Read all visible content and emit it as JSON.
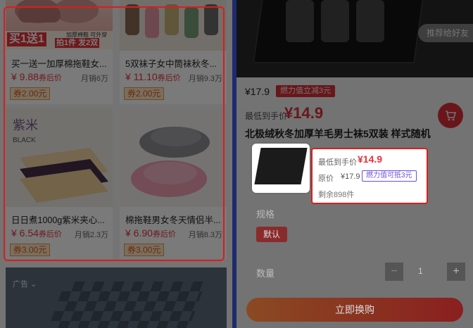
{
  "left_panel": {
    "cards": [
      {
        "title": "买一送一加厚棉拖鞋女...",
        "price": "¥ 9.88",
        "price_tag": "券后价",
        "sales": "月销6万",
        "coupon": "券2.00元",
        "banner_big": "买1送1",
        "banner_small_1": "加厚棉鞋 可外穿",
        "banner_small_2": "拍1件 发2双"
      },
      {
        "title": "5双袜子女中筒袜秋冬...",
        "price": "¥ 11.10",
        "price_tag": "券后价",
        "sales": "月销9.3万",
        "coupon": "券2.00元"
      },
      {
        "title": "日日煮1000g紫米夹心...",
        "price": "¥ 6.54",
        "price_tag": "券后价",
        "sales": "月销2.3万",
        "coupon": "券3.00元",
        "image_text_1": "紫米",
        "image_text_2": "BLACK"
      },
      {
        "title": "棉拖鞋男女冬天情侣半...",
        "price": "¥ 6.90",
        "price_tag": "券后价",
        "sales": "月销8.3万",
        "coupon": "券3.00元"
      }
    ],
    "ad_label": "广告"
  },
  "right_panel": {
    "share_button": "推荐给好友",
    "price": "¥17.9",
    "subsidy_tag": "燃力值立减3元",
    "lowest_label": "最低到手价",
    "lowest_price": "¥14.9",
    "product_title": "北极绒秋冬加厚羊毛男士袜5双装 样式随机",
    "sheet": {
      "lowest_label": "最低到手价",
      "lowest_price": "¥14.9",
      "original_label": "原价",
      "original_price": "¥17.9",
      "discount_badge": "燃力值可抵3元",
      "stock": "剩余898件",
      "spec_label": "规格",
      "spec_option": "默认",
      "quantity_label": "数量",
      "quantity_minus": "−",
      "quantity_value": "1",
      "quantity_plus": "+",
      "buy_button": "立即换购"
    }
  },
  "colors": {
    "accent_red": "#e8323c",
    "highlight_red": "#d81e1e",
    "coupon_bg": "#fde5c9",
    "badge_purple": "#6a4fd8",
    "divider_blue": "#1f2a6e"
  }
}
